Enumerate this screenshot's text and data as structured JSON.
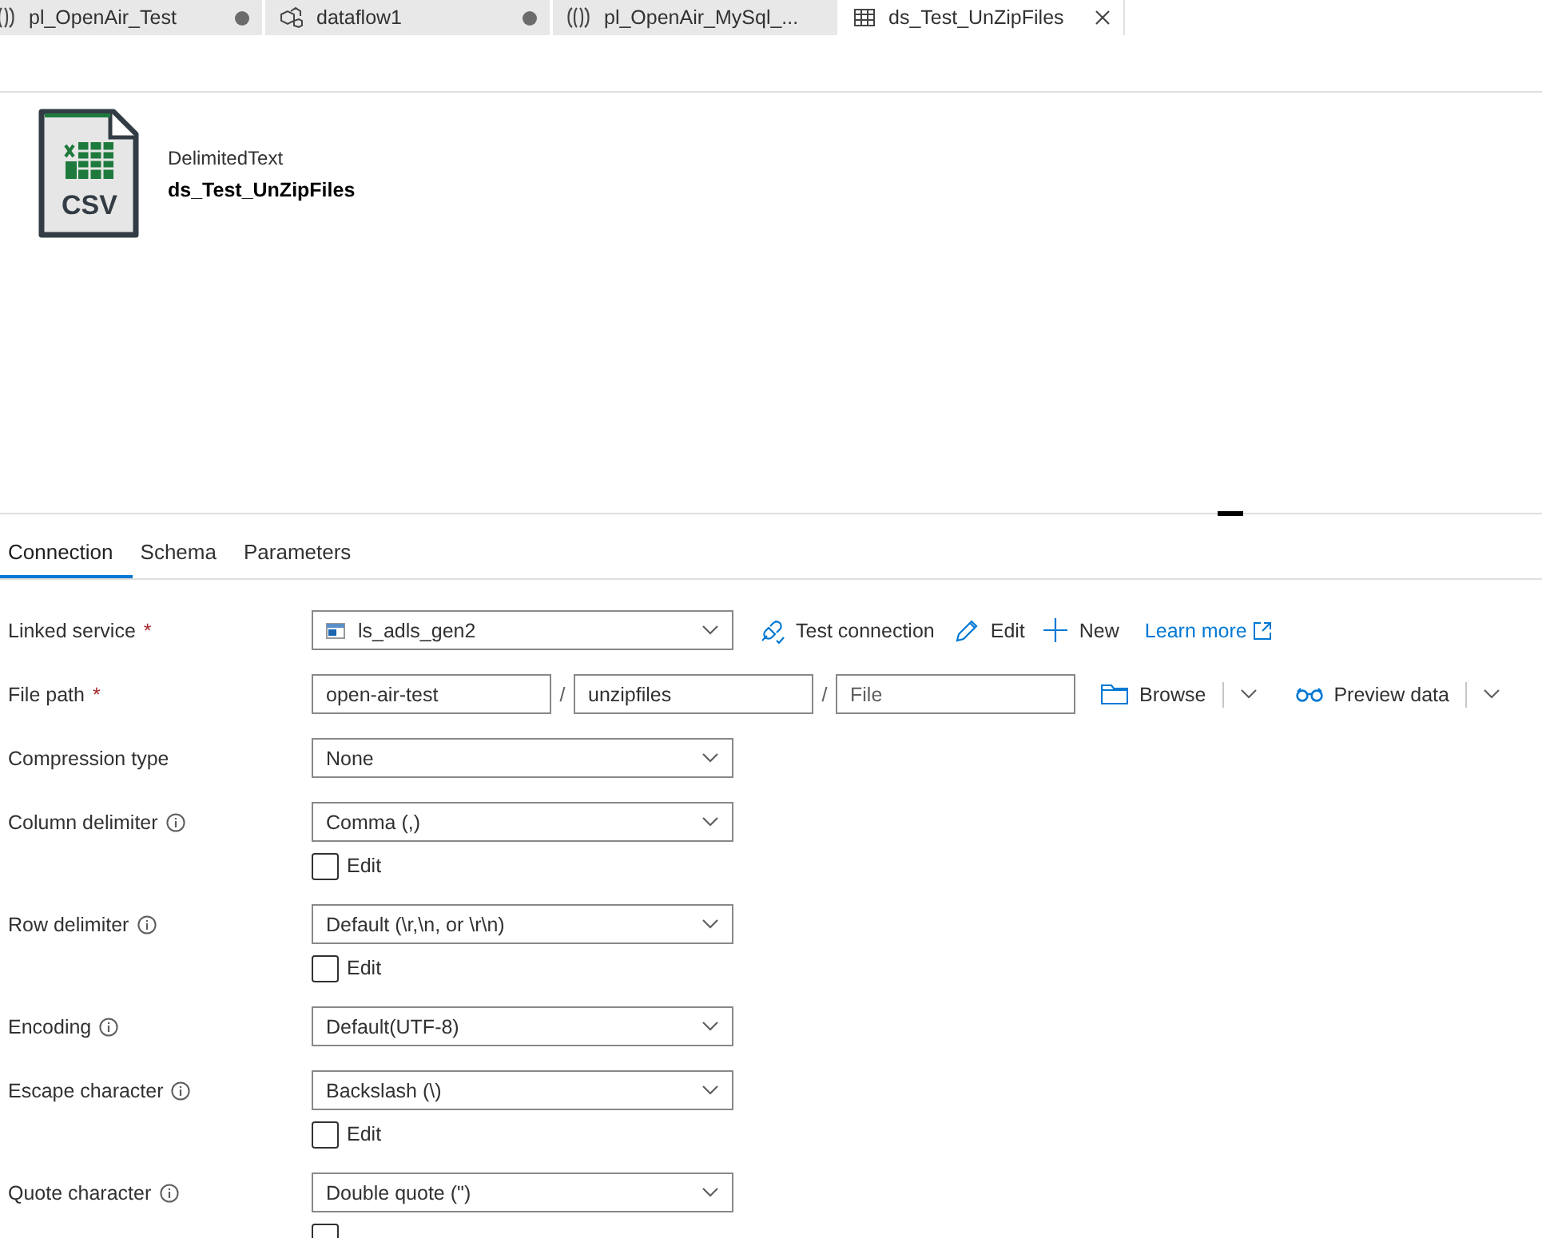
{
  "tabs": [
    {
      "kind": "pipeline",
      "label": "pl_OpenAir_Test",
      "unsaved": true,
      "selected": false
    },
    {
      "kind": "dataflow",
      "label": "dataflow1",
      "unsaved": true,
      "selected": false
    },
    {
      "kind": "pipeline",
      "label": "pl_OpenAir_MySql_...",
      "unsaved": false,
      "selected": false
    },
    {
      "kind": "dataset",
      "label": "ds_Test_UnZipFiles",
      "unsaved": false,
      "selected": true
    }
  ],
  "dataset": {
    "badge": "CSV",
    "type": "DelimitedText",
    "name": "ds_Test_UnZipFiles"
  },
  "section_tabs": [
    {
      "label": "Connection",
      "selected": true
    },
    {
      "label": "Schema",
      "selected": false
    },
    {
      "label": "Parameters",
      "selected": false
    }
  ],
  "fields": [
    {
      "kind": "linked",
      "label": "Linked service",
      "required_mark": "*",
      "value": "ls_adls_gen2",
      "actions": [
        {
          "kind": "test",
          "label": "Test connection"
        },
        {
          "kind": "edit",
          "label": "Edit"
        },
        {
          "kind": "new",
          "label": "New"
        }
      ],
      "link": "Learn more"
    },
    {
      "kind": "path",
      "label": "File path",
      "required_mark": "*",
      "segments": [
        {
          "kind": "input",
          "value": "open-air-test"
        },
        {
          "kind": "sep",
          "text": "/"
        },
        {
          "kind": "input",
          "value": "unzipfiles"
        },
        {
          "kind": "sep",
          "text": "/"
        },
        {
          "kind": "input",
          "placeholder": "File"
        }
      ],
      "buttons": [
        {
          "kind": "browse",
          "label": "Browse"
        },
        {
          "kind": "preview",
          "label": "Preview data"
        }
      ]
    },
    {
      "kind": "select",
      "label": "Compression type",
      "info": false,
      "value": "None"
    },
    {
      "kind": "select",
      "label": "Column delimiter",
      "info": true,
      "value": "Comma (,)",
      "edit_checkbox": {
        "label": "Edit",
        "checked": false
      }
    },
    {
      "kind": "select",
      "label": "Row delimiter",
      "info": true,
      "value": "Default (\\r,\\n, or \\r\\n)",
      "edit_checkbox": {
        "label": "Edit",
        "checked": false
      }
    },
    {
      "kind": "select",
      "label": "Encoding",
      "info": true,
      "value": "Default(UTF-8)"
    },
    {
      "kind": "select",
      "label": "Escape character",
      "info": true,
      "value": "Backslash (\\)",
      "edit_checkbox": {
        "label": "Edit",
        "checked": false
      }
    },
    {
      "kind": "select",
      "label": "Quote character",
      "info": true,
      "value": "Double quote (\")",
      "edit_checkbox": {
        "checked": false
      }
    }
  ]
}
